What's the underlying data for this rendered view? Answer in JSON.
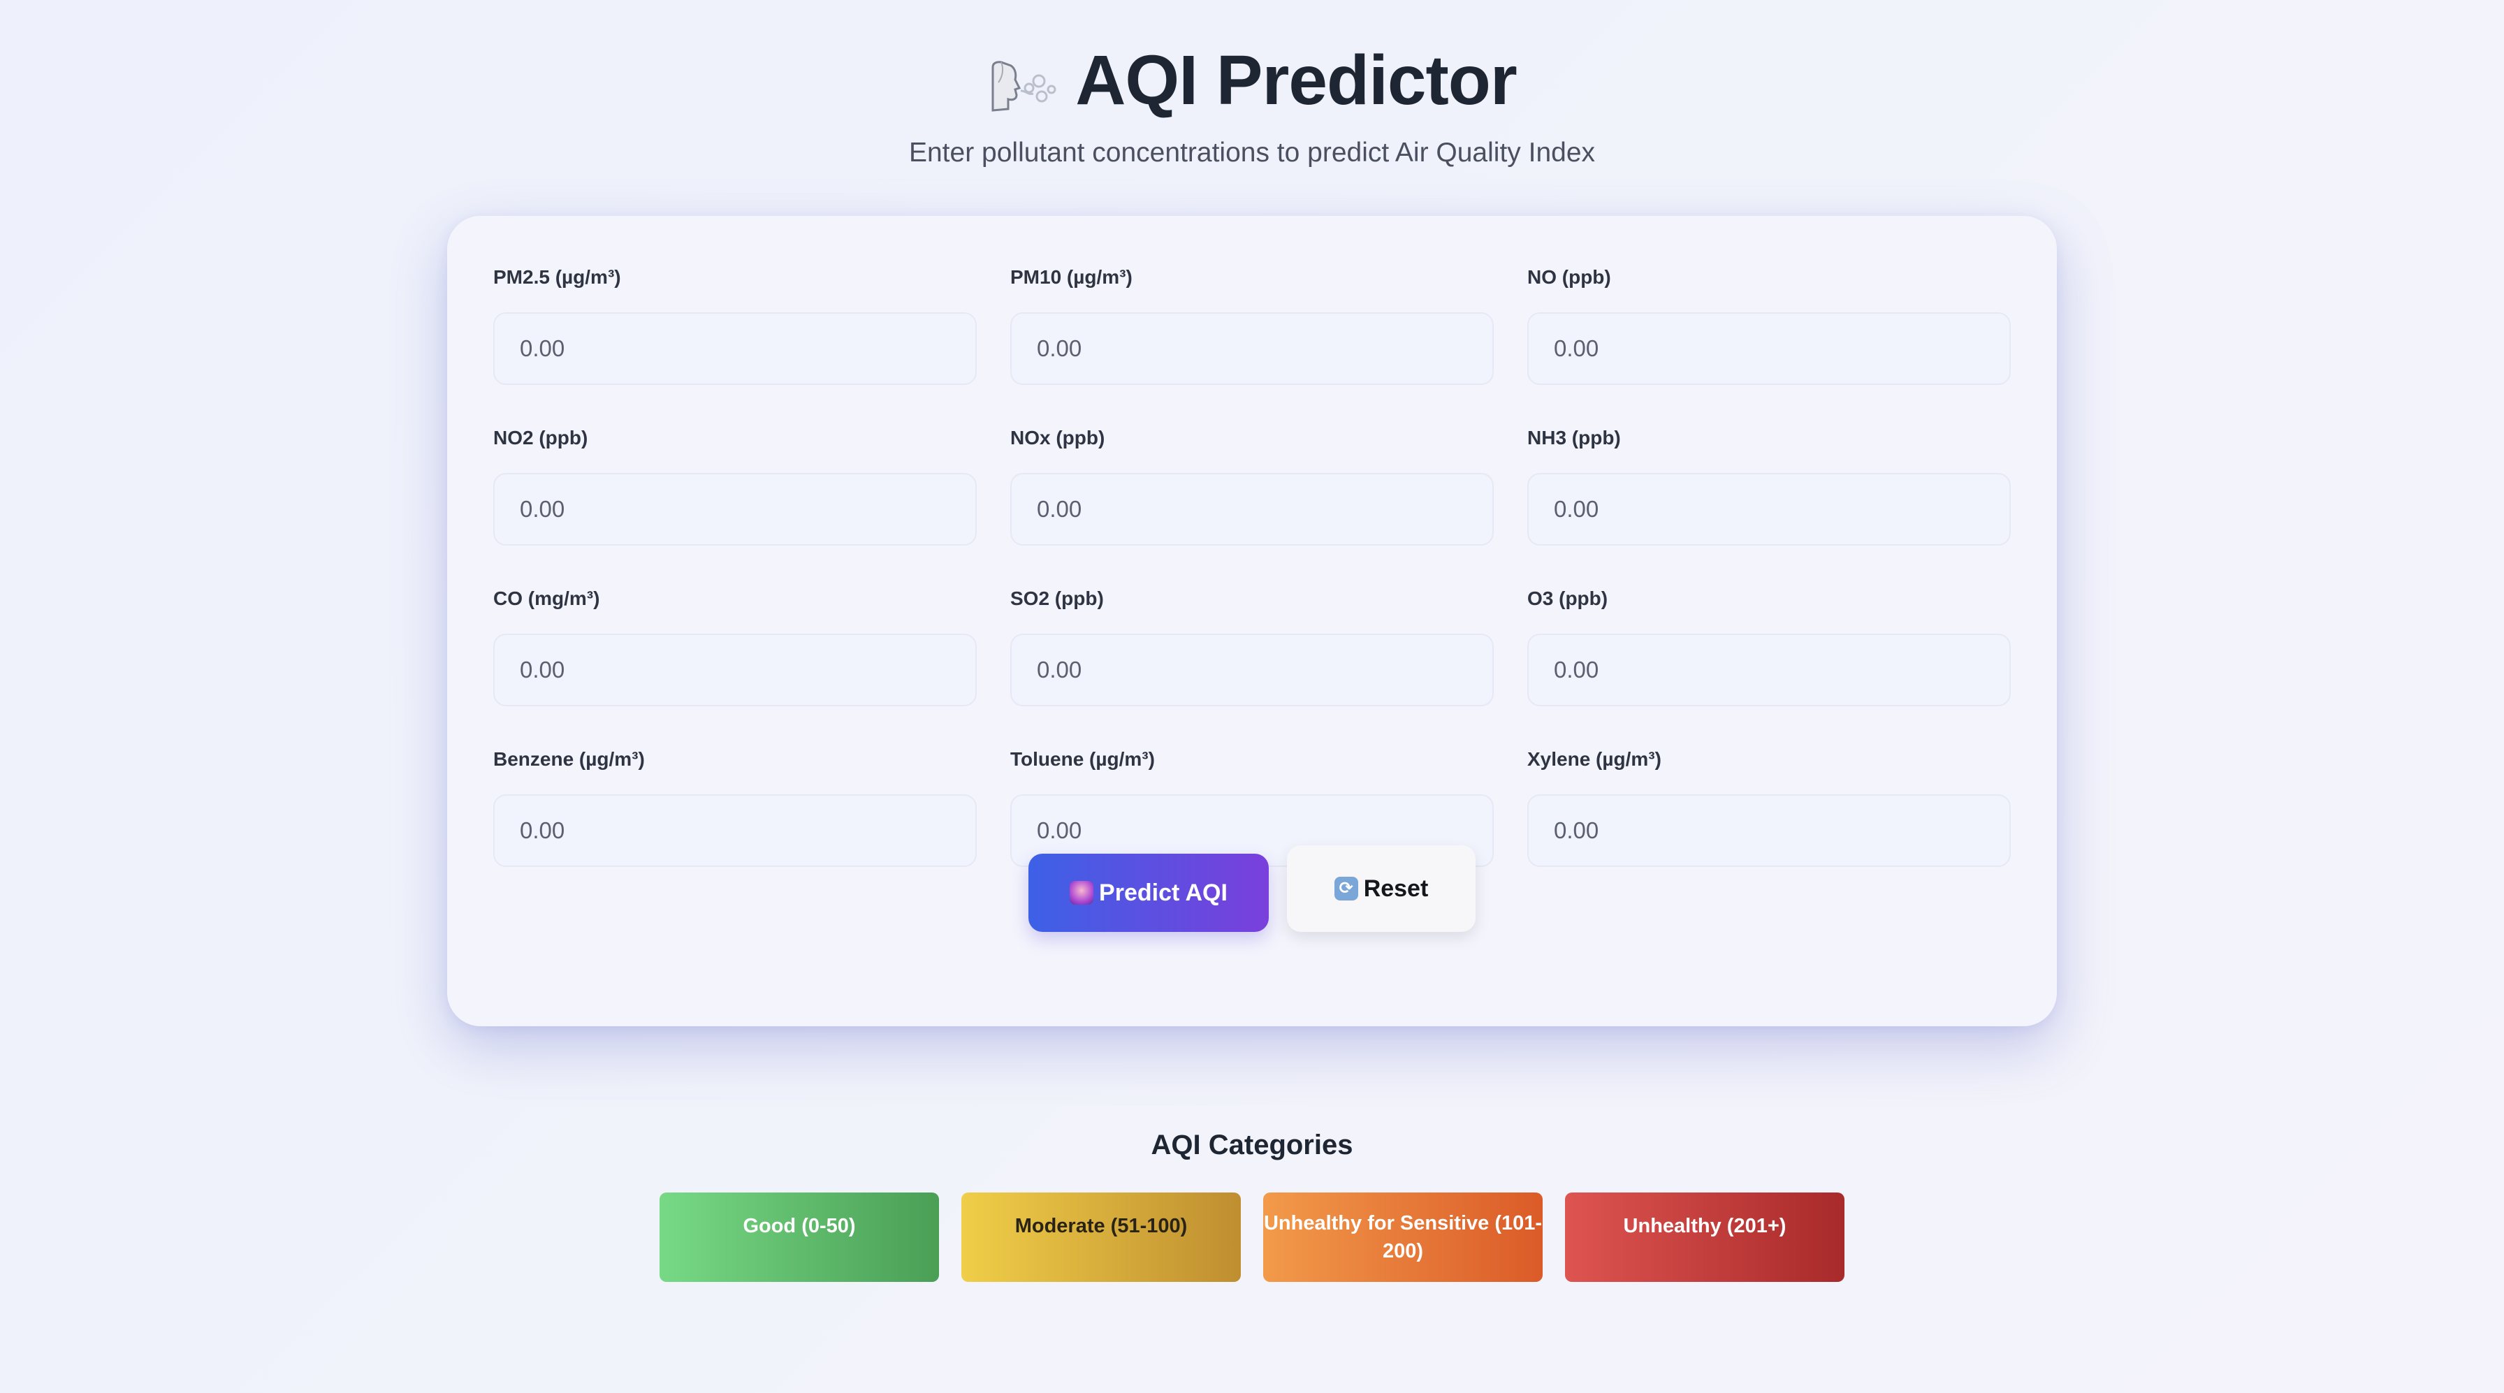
{
  "header": {
    "icon": "face-exhaling-icon",
    "title": "AQI Predictor",
    "subtitle": "Enter pollutant concentrations to predict Air Quality Index"
  },
  "form": {
    "fields": [
      {
        "label": "PM2.5 (µg/m³)",
        "placeholder": "0.00"
      },
      {
        "label": "PM10 (µg/m³)",
        "placeholder": "0.00"
      },
      {
        "label": "NO (ppb)",
        "placeholder": "0.00"
      },
      {
        "label": "NO2 (ppb)",
        "placeholder": "0.00"
      },
      {
        "label": "NOx (ppb)",
        "placeholder": "0.00"
      },
      {
        "label": "NH3 (ppb)",
        "placeholder": "0.00"
      },
      {
        "label": "CO (mg/m³)",
        "placeholder": "0.00"
      },
      {
        "label": "SO2 (ppb)",
        "placeholder": "0.00"
      },
      {
        "label": "O3 (ppb)",
        "placeholder": "0.00"
      },
      {
        "label": "Benzene (µg/m³)",
        "placeholder": "0.00"
      },
      {
        "label": "Toluene (µg/m³)",
        "placeholder": "0.00"
      },
      {
        "label": "Xylene (µg/m³)",
        "placeholder": "0.00"
      }
    ],
    "predict_button": {
      "label": "Predict AQI",
      "icon": "crystal-ball-icon"
    },
    "reset_button": {
      "label": "Reset",
      "icon": "refresh-icon"
    }
  },
  "categories": {
    "title": "AQI Categories",
    "items": [
      {
        "label": "Good (0-50)",
        "color": "#4caf50"
      },
      {
        "label": "Moderate (51-100)",
        "color": "#e0b13a"
      },
      {
        "label": "Unhealthy for Sensitive (101-200)",
        "color": "#e8793a"
      },
      {
        "label": "Unhealthy (201+)",
        "color": "#c23a3a"
      }
    ]
  }
}
